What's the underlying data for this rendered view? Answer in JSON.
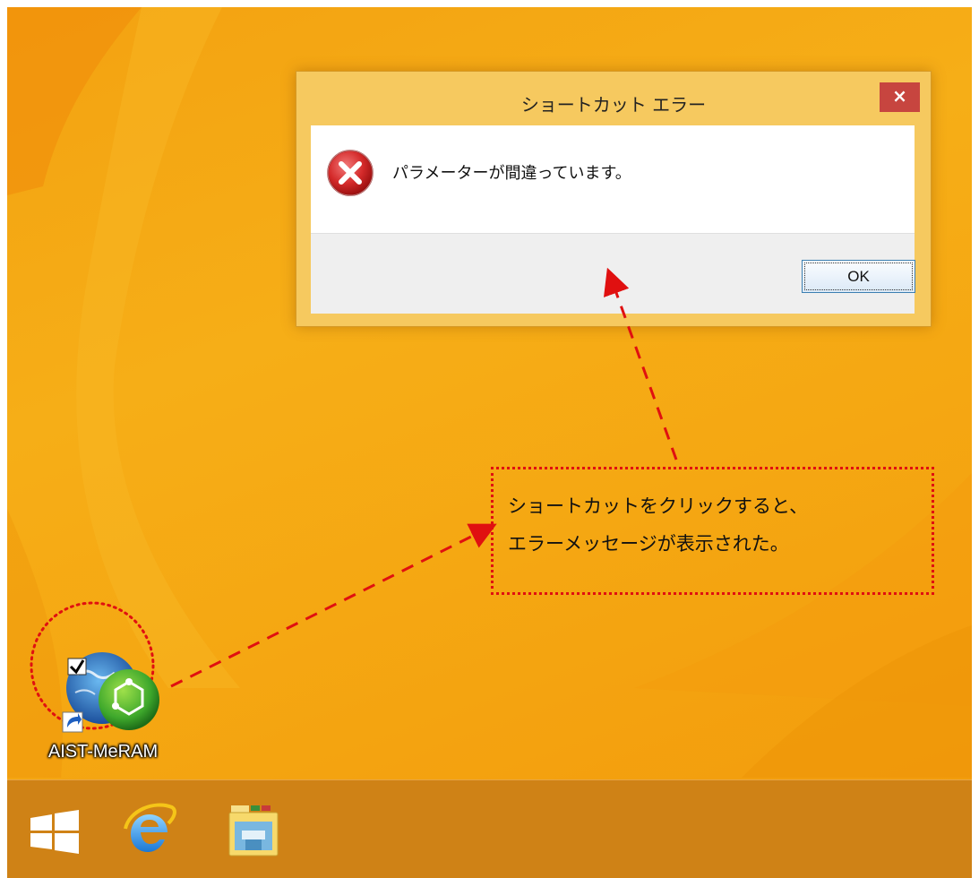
{
  "dialog": {
    "title": "ショートカット エラー",
    "close_label": "×",
    "message": "パラメーターが間違っています。",
    "ok_label": "OK"
  },
  "annotation": {
    "line1": "ショートカットをクリックすると、",
    "line2": "エラーメッセージが表示された。"
  },
  "desktop": {
    "shortcut_label": "AIST-MeRAM"
  },
  "taskbar": {
    "items": [
      "windows-start",
      "internet-explorer",
      "file-explorer"
    ]
  },
  "colors": {
    "desktop_background": "#f5a712",
    "annotation_red": "#e01010",
    "close_button": "#c7453f",
    "taskbar": "#cf8216"
  }
}
